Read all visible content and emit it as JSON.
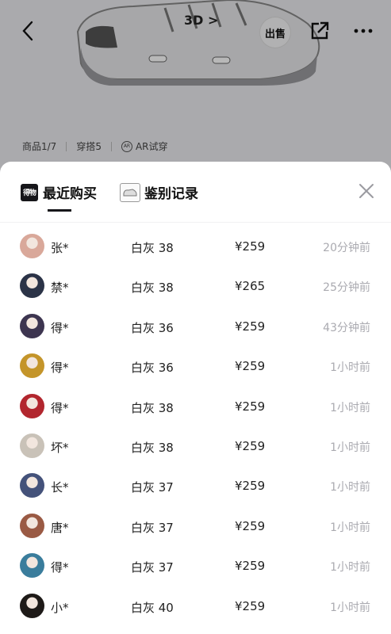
{
  "background": {
    "view_3d_label": "3D >",
    "sell_label": "出售",
    "sub_tabs": [
      {
        "label": "商品1/7"
      },
      {
        "label": "穿搭5"
      },
      {
        "label": "AR试穿"
      }
    ]
  },
  "sheet": {
    "tabs": [
      {
        "label": "最近购买",
        "logo_text": "得物"
      },
      {
        "label": "鉴别记录"
      }
    ],
    "purchases": [
      {
        "name": "张*",
        "spec": "白灰 38",
        "price": "¥259",
        "time": "20分钟前",
        "avatar_color": "#d9a89a"
      },
      {
        "name": "禁*",
        "spec": "白灰 38",
        "price": "¥265",
        "time": "25分钟前",
        "avatar_color": "#2b3347"
      },
      {
        "name": "得*",
        "spec": "白灰 36",
        "price": "¥259",
        "time": "43分钟前",
        "avatar_color": "#3d3550"
      },
      {
        "name": "得*",
        "spec": "白灰 36",
        "price": "¥259",
        "time": "1小时前",
        "avatar_color": "#c4952a"
      },
      {
        "name": "得*",
        "spec": "白灰 38",
        "price": "¥259",
        "time": "1小时前",
        "avatar_color": "#b2262e"
      },
      {
        "name": "坏*",
        "spec": "白灰 38",
        "price": "¥259",
        "time": "1小时前",
        "avatar_color": "#c9c2b8"
      },
      {
        "name": "长*",
        "spec": "白灰 37",
        "price": "¥259",
        "time": "1小时前",
        "avatar_color": "#44527a"
      },
      {
        "name": "唐*",
        "spec": "白灰 37",
        "price": "¥259",
        "time": "1小时前",
        "avatar_color": "#9a5a44"
      },
      {
        "name": "得*",
        "spec": "白灰 37",
        "price": "¥259",
        "time": "1小时前",
        "avatar_color": "#3a7d9c"
      },
      {
        "name": "小*",
        "spec": "白灰 40",
        "price": "¥259",
        "time": "1小时前",
        "avatar_color": "#1e1a18"
      }
    ]
  }
}
